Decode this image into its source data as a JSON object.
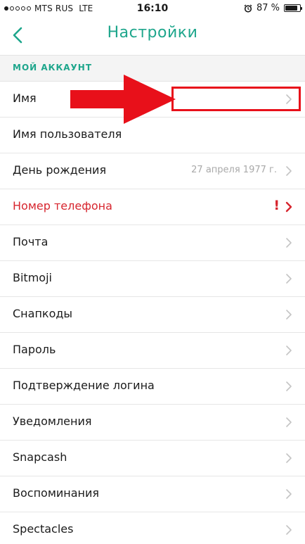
{
  "status_bar": {
    "carrier": "MTS RUS",
    "network": "LTE",
    "time": "16:10",
    "battery_text": "87 %",
    "battery_level": 0.87,
    "icons": [
      "signal-dots-icon",
      "alarm-icon",
      "battery-icon"
    ]
  },
  "nav": {
    "title": "Настройки",
    "back_icon": "chevron-left-icon"
  },
  "section": {
    "title": "МОЙ АККАУНТ"
  },
  "rows": [
    {
      "label": "Имя",
      "value": "",
      "chevron": true,
      "alert": false
    },
    {
      "label": "Имя пользователя",
      "value": "",
      "chevron": false,
      "alert": false
    },
    {
      "label": "День рождения",
      "value": "27 апреля 1977 г.",
      "chevron": true,
      "alert": false
    },
    {
      "label": "Номер телефона",
      "value": "",
      "chevron": true,
      "alert": true,
      "alert_mark": "!"
    },
    {
      "label": "Почта",
      "value": "",
      "chevron": true,
      "alert": false
    },
    {
      "label": "Bitmoji",
      "value": "",
      "chevron": true,
      "alert": false
    },
    {
      "label": "Снапкоды",
      "value": "",
      "chevron": true,
      "alert": false
    },
    {
      "label": "Пароль",
      "value": "",
      "chevron": true,
      "alert": false
    },
    {
      "label": "Подтверждение логина",
      "value": "",
      "chevron": true,
      "alert": false
    },
    {
      "label": "Уведомления",
      "value": "",
      "chevron": true,
      "alert": false
    },
    {
      "label": "Snapcash",
      "value": "",
      "chevron": true,
      "alert": false
    },
    {
      "label": "Воспоминания",
      "value": "",
      "chevron": true,
      "alert": false
    },
    {
      "label": "Spectacles",
      "value": "",
      "chevron": true,
      "alert": false
    }
  ],
  "colors": {
    "accent": "#1ea68c",
    "alert": "#d7262f",
    "chevron": "#c4c4c4",
    "annotation": "#e8101a"
  }
}
